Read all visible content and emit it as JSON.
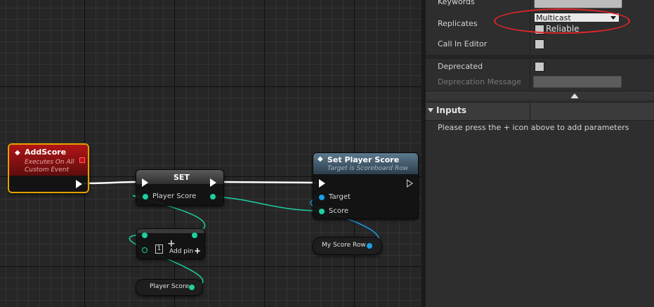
{
  "graph": {
    "event_node": {
      "title": "AddScore",
      "sub1": "Executes On All",
      "sub2": "Custom Event"
    },
    "set_node": {
      "title": "SET",
      "pin_label": "Player Score"
    },
    "array_node": {
      "index": "1",
      "add_pin": "Add pin"
    },
    "getter_player_score": {
      "label": "Player Score"
    },
    "getter_my_score_row": {
      "label": "My Score Row"
    },
    "func_node": {
      "title": "Set Player Score",
      "subtitle": "Target is Scoreboard Row",
      "pin_target": "Target",
      "pin_score": "Score"
    }
  },
  "details": {
    "keywords_label": "Keywords",
    "replicates_label": "Replicates",
    "replicates_value": "Multicast",
    "reliable_label": "Reliable",
    "call_in_editor_label": "Call In Editor",
    "deprecated_label": "Deprecated",
    "deprecation_message_label": "Deprecation Message",
    "inputs_header": "Inputs",
    "inputs_hint": "Please press the + icon above to add parameters"
  },
  "colors": {
    "exec_wire": "#ffffff",
    "int_wire": "#1dcfa0",
    "object_wire": "#1a9fe8",
    "highlight": "#e0262a",
    "event_border": "#e3a100"
  }
}
